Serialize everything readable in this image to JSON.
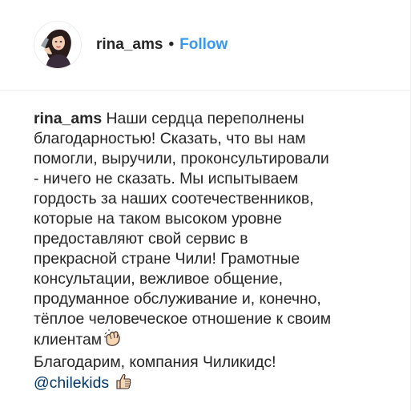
{
  "header": {
    "username": "rina_ams",
    "separator": "•",
    "follow_label": "Follow"
  },
  "caption": {
    "username": "rina_ams",
    "lines": [
      "Наши сердца переполнены",
      "благодарностью! Сказать, что вы нам",
      "помогли, выручили, проконсультировали",
      "- ничего не сказать. Мы испытываем",
      "гордость за наших соотечественников,",
      "которые на таком высоком уровне",
      "предоставляют свой сервис в",
      "прекрасной стране Чили! Грамотные",
      "консультации, вежливое общение,",
      "продуманное обслуживание и, конечно,",
      "тёплое человеческое отношение к своим",
      "клиентам"
    ],
    "thanks_line": "Благодарим, компания Чиликидс!",
    "mention": "@chilekids",
    "emoji_clapping": "clapping-hands-icon",
    "emoji_thumbs": "thumbs-up-icon"
  },
  "colors": {
    "text": "#262626",
    "link_blue": "#3897f0",
    "mention": "#003569",
    "divider": "#efefef"
  }
}
